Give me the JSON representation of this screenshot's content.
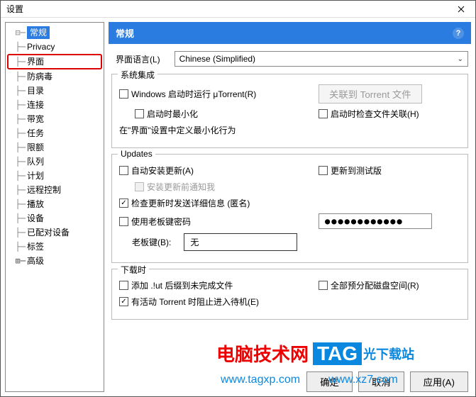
{
  "window": {
    "title": "设置"
  },
  "sidebar": {
    "items": [
      {
        "label": "常规",
        "selected": true
      },
      {
        "label": "Privacy"
      },
      {
        "label": "界面",
        "highlighted": true
      },
      {
        "label": "防病毒"
      },
      {
        "label": "目录"
      },
      {
        "label": "连接"
      },
      {
        "label": "带宽"
      },
      {
        "label": "任务"
      },
      {
        "label": "限额"
      },
      {
        "label": "队列"
      },
      {
        "label": "计划"
      },
      {
        "label": "远程控制"
      },
      {
        "label": "播放"
      },
      {
        "label": "设备"
      },
      {
        "label": "已配对设备"
      },
      {
        "label": "标签"
      },
      {
        "label": "高级",
        "expander": "+"
      }
    ]
  },
  "header": {
    "title": "常规"
  },
  "lang": {
    "label": "界面语言(L)",
    "value": "Chinese (Simplified)"
  },
  "groups": {
    "sys": {
      "title": "系统集成",
      "startup": "Windows 启动时运行 μTorrent(R)",
      "assoc_btn": "关联到 Torrent 文件",
      "minimize": "启动时最小化",
      "check_assoc": "启动时检查文件关联(H)",
      "note": "在\"界面\"设置中定义最小化行为"
    },
    "updates": {
      "title": "Updates",
      "auto": "自动安装更新(A)",
      "beta": "更新到测试版",
      "notify": "安装更新前通知我",
      "anon": "检查更新时发送详细信息 (匿名)",
      "boss_pwd": "使用老板键密码",
      "boss_label": "老板键(B):",
      "boss_value": "无",
      "password_mask": "●●●●●●●●●●●●"
    },
    "download": {
      "title": "下载时",
      "ut_ext": "添加 .!ut 后缀到未完成文件",
      "prealloc": "全部预分配磁盘空间(R)",
      "standby": "有活动 Torrent 时阻止进入待机(E)"
    }
  },
  "footer": {
    "ok": "确定",
    "cancel": "取消",
    "apply": "应用(A)"
  },
  "overlay": {
    "text1": "电脑技术网",
    "tag": "TAG",
    "rest": "光下载站",
    "url1": "www.tagxp.com",
    "url2": "www.xz7.com"
  }
}
